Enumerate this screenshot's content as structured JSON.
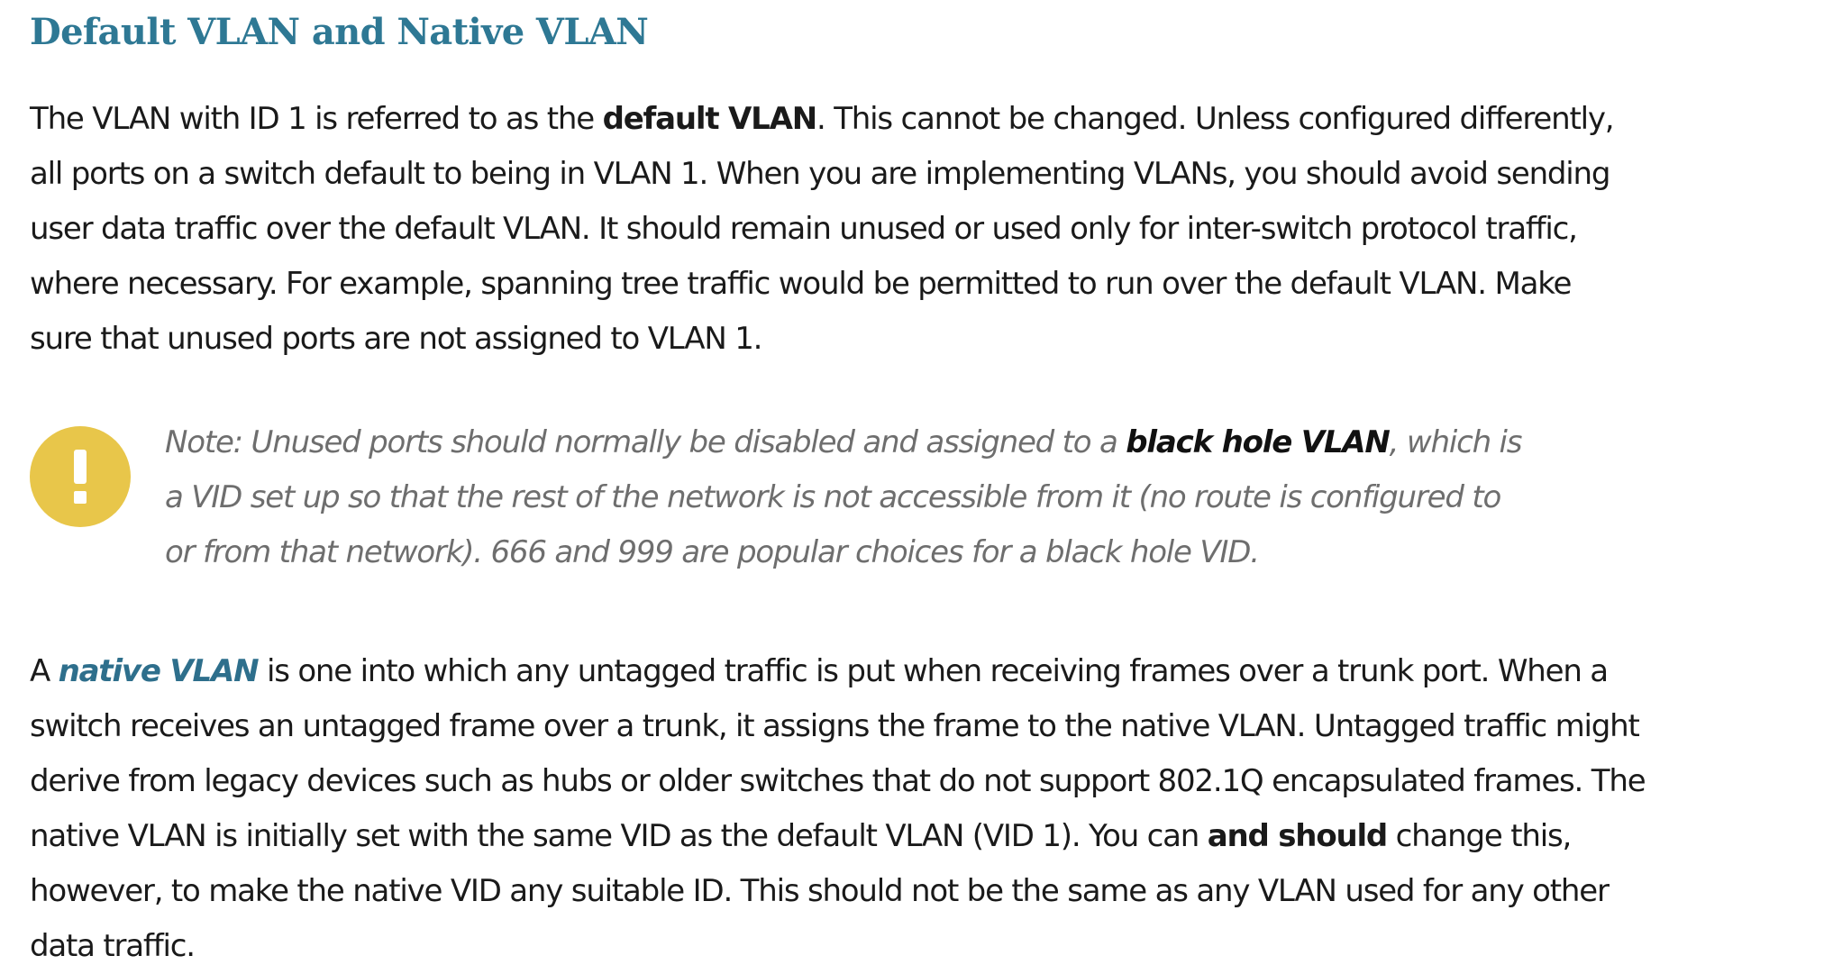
{
  "heading": "Default VLAN and Native VLAN",
  "para1": {
    "l1a": "The VLAN with ID 1 is referred to as the ",
    "l1b": "default VLAN",
    "l1c": ". This cannot be changed. Unless configured differently,",
    "l2": "all ports on a switch default to being in VLAN 1. When you are implementing VLANs, you should avoid sending",
    "l3": "user data traffic over the default VLAN. It should remain unused or used only for inter-switch protocol traffic,",
    "l4": "where necessary. For example, spanning tree traffic would be permitted to run over the default VLAN. Make",
    "l5": "sure that unused ports are not assigned to VLAN 1."
  },
  "note": {
    "icon": "exclamation-icon",
    "icon_color": "#e8c64a",
    "l1a": "Note: Unused ports should normally be disabled and assigned to a ",
    "l1b": "black hole VLAN",
    "l1c": ", which is",
    "l2": "a VID set up so that the rest of the network is not accessible from it (no route is configured to",
    "l3": "or from that network). 666 and 999 are popular choices for a black hole VID."
  },
  "para2": {
    "l1a": "A ",
    "l1b": "native VLAN",
    "l1c": " is one into which any untagged traffic is put when receiving frames over a trunk port. When a",
    "l2": "switch receives an untagged frame over a trunk, it assigns the frame to the native VLAN. Untagged traffic might",
    "l3": "derive from legacy devices such as hubs or older switches that do not support 802.1Q encapsulated frames. The",
    "l4a": "native VLAN is initially set with the same VID as the default VLAN (VID 1). You can ",
    "l4b": "and should",
    "l4c": " change this,",
    "l5": "however, to make the native VID any suitable ID. This should not be the same as any VLAN used for any other",
    "l6": "data traffic."
  },
  "colors": {
    "heading": "#2e7894",
    "term": "#2e6f8c",
    "note_text": "#6e6e6e"
  }
}
